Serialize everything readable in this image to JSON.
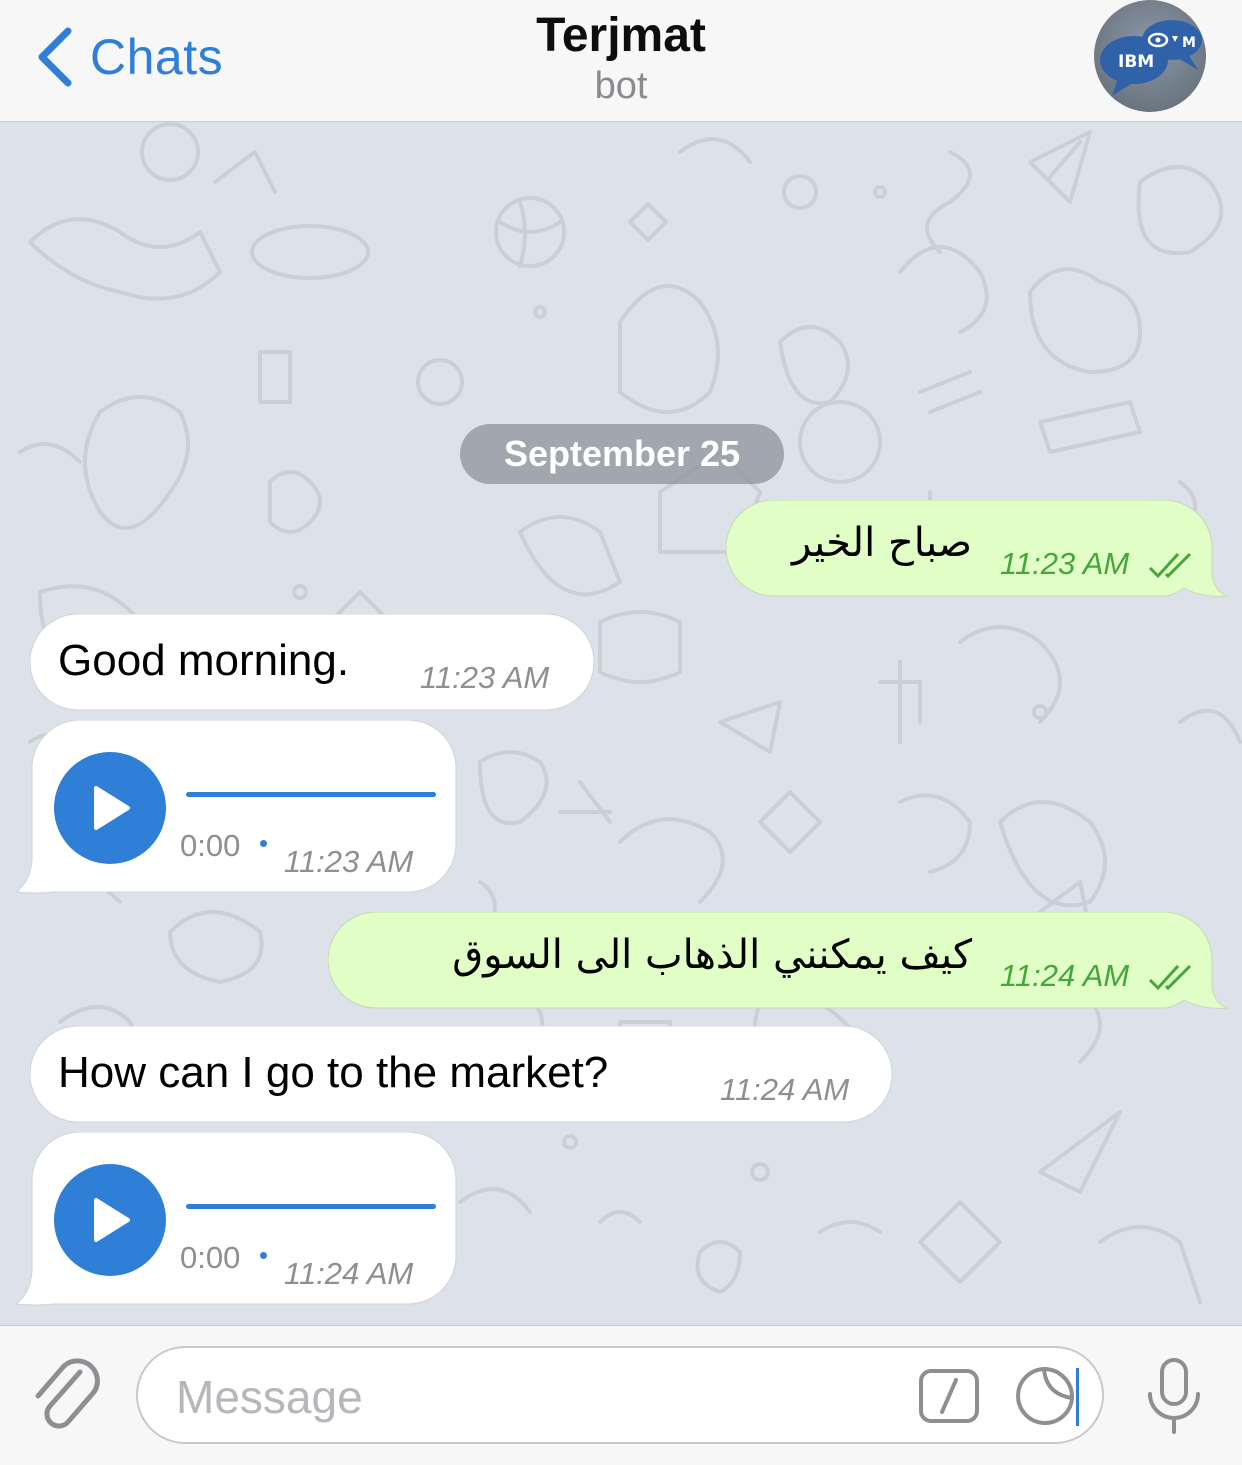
{
  "header": {
    "back_label": "Chats",
    "title": "Terjmat",
    "subtitle": "bot",
    "avatar_text": "IBM"
  },
  "chat": {
    "date": "September 25",
    "messages": [
      {
        "direction": "out",
        "text": "صباح الخير",
        "time": "11:23 AM",
        "status": "read"
      },
      {
        "direction": "in",
        "text": "Good morning.",
        "time": "11:23 AM"
      },
      {
        "direction": "in",
        "type": "voice",
        "duration": "0:00",
        "time": "11:23 AM"
      },
      {
        "direction": "out",
        "text": "كيف يمكنني الذهاب الى السوق",
        "time": "11:24 AM",
        "status": "read"
      },
      {
        "direction": "in",
        "text": "How can I go to the market?",
        "time": "11:24 AM"
      },
      {
        "direction": "in",
        "type": "voice",
        "duration": "0:00",
        "time": "11:24 AM"
      }
    ]
  },
  "input": {
    "placeholder": "Message"
  },
  "icons": {
    "back": "chevron-left-icon",
    "attach": "paperclip-icon",
    "commands": "slash-command-icon",
    "sticker": "sticker-icon",
    "mic": "microphone-icon",
    "play": "play-icon",
    "read_status": "double-check-icon"
  },
  "colors": {
    "accent": "#2f7fd6",
    "outgoing_bubble": "#e1fec6",
    "incoming_bubble": "#ffffff",
    "outgoing_time": "#45a63c",
    "chat_background": "#dde2ea"
  }
}
